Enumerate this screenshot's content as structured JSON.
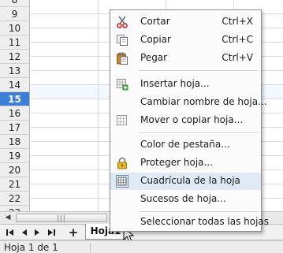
{
  "rows": {
    "numbers": [
      "8",
      "9",
      "10",
      "11",
      "12",
      "13",
      "14",
      "15",
      "16",
      "17",
      "18",
      "19",
      "20",
      "21",
      "22",
      "23",
      "24"
    ],
    "active": "15"
  },
  "context_menu": {
    "items": [
      {
        "label": "Cortar",
        "shortcut": "Ctrl+X",
        "icon": "scissors-icon"
      },
      {
        "label": "Copiar",
        "shortcut": "Ctrl+C",
        "icon": "copy-icon"
      },
      {
        "label": "Pegar",
        "shortcut": "Ctrl+V",
        "icon": "paste-icon"
      },
      {
        "label": "Insertar hoja...",
        "icon": "insert-sheet-icon"
      },
      {
        "label": "Cambiar nombre de hoja..."
      },
      {
        "label": "Mover o copiar hoja...",
        "icon": "move-copy-sheet-icon"
      },
      {
        "label": "Color de pestaña..."
      },
      {
        "label": "Proteger hoja...",
        "icon": "lock-icon"
      },
      {
        "label": "Cuadrícula de la hoja",
        "icon": "grid-toggle-icon"
      },
      {
        "label": "Sucesos de hoja..."
      },
      {
        "label": "Seleccionar todas las hojas"
      }
    ]
  },
  "tabbar": {
    "nav_first": "◀",
    "nav_prev": "◀",
    "nav_next": "▶",
    "nav_last": "▶",
    "add": "+",
    "sheet_tab": "Hoja1"
  },
  "scrollbar": {
    "left_arrow": "◀",
    "thumb_grip": "|||"
  },
  "statusbar": {
    "sheet_position": "Hoja 1 de 1"
  },
  "colors": {
    "active_row_header": "#3d7fd6",
    "menu_hover": "#dfe9f5"
  }
}
